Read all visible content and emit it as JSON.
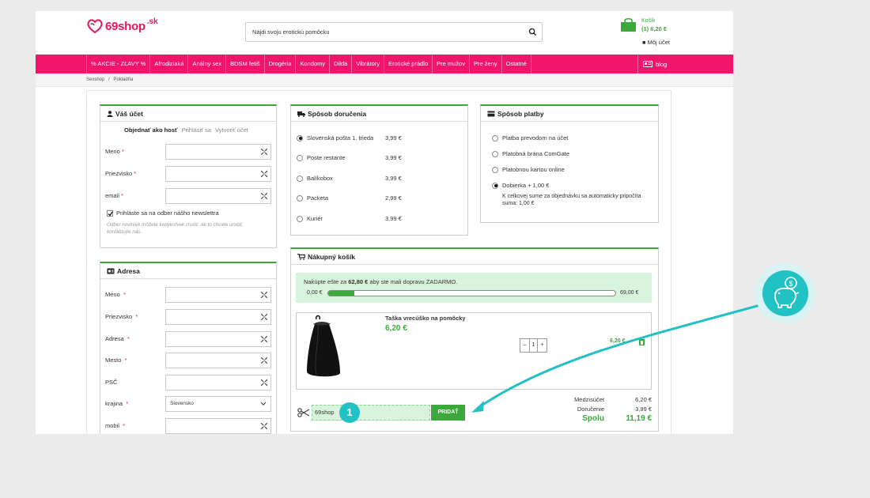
{
  "header": {
    "logo_text": "69shop",
    "logo_suffix": ".sk",
    "search_placeholder": "Nájdi svoju erotickú pomôcku",
    "cart_label": "Košík",
    "cart_summary": "(1) 6,20 €",
    "account_label": "Môj účet"
  },
  "nav": {
    "items": [
      "% AKCIE - ZĽAVY %",
      "Afrodiziaká",
      "Análny sex",
      "BDSM fetiš",
      "Drogéria",
      "Kondomy",
      "Dildá",
      "Vibrátory",
      "Erotické prádlo",
      "Pre mužov",
      "Pre ženy",
      "Ostatné"
    ],
    "blog": "blog"
  },
  "breadcrumb": {
    "items": [
      "Sexshop",
      "/",
      "Pokladňa"
    ]
  },
  "account_box": {
    "title": "Váš účet",
    "tabs": [
      "Objednať ako hosť",
      "Prihlásiť sa",
      "Vytvoriť účet"
    ],
    "fields": [
      {
        "label": "Meno"
      },
      {
        "label": "Priezvisko"
      },
      {
        "label": "email"
      }
    ],
    "newsletter": "Prihláste sa na odber nášho newslettra",
    "newsletter_note": "Odber noviniek môžete kedykoľvek zrušiť. Ak to chcete urobiť, kontaktujte nás."
  },
  "address_box": {
    "title": "Adresa",
    "fields": [
      {
        "label": "Meno",
        "required": true
      },
      {
        "label": "Priezvisko",
        "required": true
      },
      {
        "label": "Adresa",
        "required": true
      },
      {
        "label": "Mesto",
        "required": true
      },
      {
        "label": "PSČ",
        "required": false
      },
      {
        "label": "krajina",
        "required": true,
        "value": "Slovensko"
      },
      {
        "label": "mobil",
        "required": true
      }
    ]
  },
  "shipping_box": {
    "title": "Spôsob doručenia",
    "options": [
      {
        "label": "Slovenská pošta 1. trieda",
        "price": "3,99 €",
        "selected": true
      },
      {
        "label": "Poste restante",
        "price": "3,99 €",
        "selected": false
      },
      {
        "label": "Balíkobox",
        "price": "3,99 €",
        "selected": false
      },
      {
        "label": "Packeta",
        "price": "2,99 €",
        "selected": false
      },
      {
        "label": "Kuriér",
        "price": "3,99 €",
        "selected": false
      }
    ]
  },
  "payment_box": {
    "title": "Spôsob platby",
    "options": [
      {
        "label": "Platba prevodom na účet",
        "selected": false
      },
      {
        "label": "Platobná brána ComGate",
        "selected": false
      },
      {
        "label": "Platobnou kartou online",
        "selected": false
      },
      {
        "label": "Dobierka + 1,00 €",
        "selected": true
      }
    ],
    "cod_note": "K celkovej sume za objednávku sa automaticky pripočíta suma: 1,00 €"
  },
  "cart_box": {
    "title": "Nákupný košík",
    "free_shipping_pre": "Nakúpte ešte za",
    "free_shipping_amount": "62,80 €",
    "free_shipping_post": "aby ste mali dopravu ZADARMO.",
    "progress_min": "0,00 €",
    "progress_max": "69,00 €",
    "progress_fraction": 0.09,
    "product_name": "Taška vrecúško na pomôcky",
    "product_price": "6,20 €",
    "quantity": "1",
    "qty_minus": "–",
    "qty_plus": "+",
    "line_total": "6,20 €",
    "coupon_value": "69shop",
    "coupon_button": "PRIDAŤ",
    "callout_number": "1",
    "subtotal_label": "Medzisúčet",
    "subtotal": "6,20 €",
    "delivery_label": "Doručenie",
    "delivery": "3,99 €",
    "total_label": "Spolu",
    "total": "11,19 €"
  },
  "colors": {
    "brand_pink": "#f0146a",
    "accent_green": "#3aa83a",
    "teal": "#22c1c3"
  }
}
